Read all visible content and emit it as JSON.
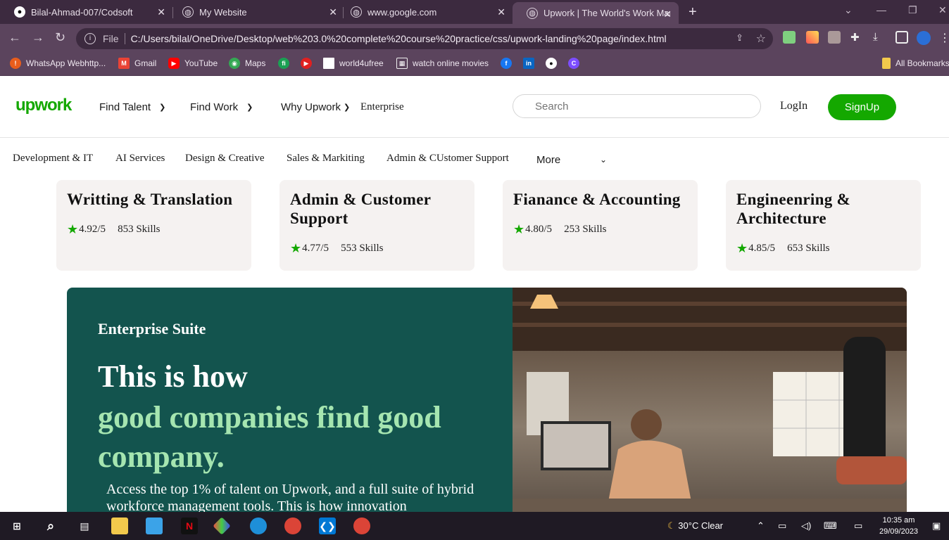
{
  "browser": {
    "tabs": [
      {
        "title": "Bilal-Ahmad-007/Codsoft",
        "icon": "github-icon",
        "active": false
      },
      {
        "title": "My Website",
        "icon": "globe-icon",
        "active": false
      },
      {
        "title": "www.google.com",
        "icon": "globe-icon",
        "active": false
      },
      {
        "title": "Upwork | The World's Work Mar",
        "icon": "globe-icon",
        "active": true
      }
    ],
    "address": {
      "scheme": "File",
      "url": "C:/Users/bilal/OneDrive/Desktop/web%203.0%20complete%20course%20practice/css/upwork-landing%20page/index.html"
    },
    "bookmarks": [
      "WhatsApp Webhttp...",
      "Gmail",
      "YouTube",
      "Maps",
      "world4ufree",
      "watch online movies",
      "All Bookmarks"
    ]
  },
  "site": {
    "logo": "upwork",
    "nav": {
      "find_talent": "Find Talent",
      "find_work": "Find Work",
      "why_upwork": "Why Upwork",
      "enterprise": "Enterprise"
    },
    "search_placeholder": "Search",
    "login": "LogIn",
    "signup": "SignUp",
    "categories": [
      "Development & IT",
      "AI Services",
      "Design & Creative",
      "Sales & Markiting",
      "Admin & CUstomer Support"
    ],
    "more": "More",
    "cards": [
      {
        "title": "Writting & Translation",
        "rating": "4.92/5",
        "skills": "853 Skills"
      },
      {
        "title": "Admin & Customer Support",
        "rating": "4.77/5",
        "skills": "553 Skills"
      },
      {
        "title": "Fianance & Accounting",
        "rating": "4.80/5",
        "skills": "253 Skills"
      },
      {
        "title": "Engineenring & Architecture",
        "rating": "4.85/5",
        "skills": "653 Skills"
      }
    ],
    "banner": {
      "eyebrow": "Enterprise Suite",
      "headline_white": "This is how",
      "headline_green": "good companies find good company.",
      "description": "Access the top 1% of talent on Upwork, and a full suite of hybrid workforce management tools. This is how innovation"
    }
  },
  "taskbar": {
    "weather": "30°C  Clear",
    "time": "10:35 am",
    "date": "29/09/2023"
  },
  "colors": {
    "brand_green": "#14a800",
    "banner_bg": "#13544e",
    "headline_green": "#a5e5b0",
    "card_bg": "#f5f2f1"
  }
}
